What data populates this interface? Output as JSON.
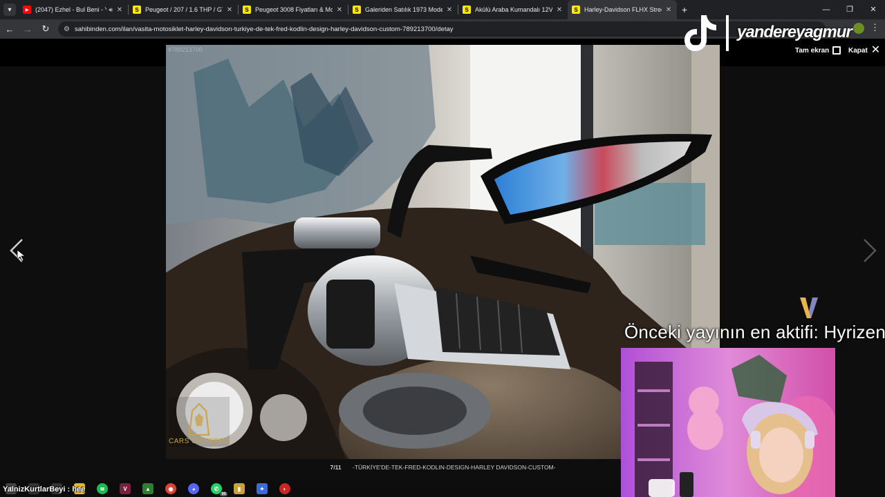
{
  "browser": {
    "tabs": [
      {
        "label": "(2047) Ezhel - Bul Beni - Yo",
        "favicon": "youtube-icon",
        "has_audio": true
      },
      {
        "label": "Peugeot / 207 / 1.6 THP / GT / ...",
        "favicon": "sahibinden-icon"
      },
      {
        "label": "Peugeot 3008 Fiyatları & Mode",
        "favicon": "sahibinden-icon"
      },
      {
        "label": "Galeriden Satılık 1973 Model K",
        "favicon": "sahibinden-icon"
      },
      {
        "label": "Akülü Araba Kumandalı 12V Ve",
        "favicon": "sahibinden-icon"
      },
      {
        "label": "Harley-Davidson FLHX Street G",
        "favicon": "sahibinden-icon",
        "active": true
      }
    ],
    "favicon_letter": "S",
    "new_tab_symbol": "+",
    "url": "sahibinden.com/ilan/vasita-motosiklet-harley-davidson-turkiye-de-tek-fred-kodlin-design-harley-davidson-custom-789213700/detay"
  },
  "viewer": {
    "photo_id": "#789213700",
    "watermark_brand": "CARS OF FERRO",
    "counter": "7/11",
    "caption": "-TÜRKİYE'DE-TEK-FRED-KODLIN-DESIGN-HARLEY DAVIDSON-CUSTOM-",
    "fullscreen_label": "Tam ekran",
    "close_label": "Kapat"
  },
  "stream": {
    "tiktok_username": "yandereyagmur",
    "previous_top_chatter": "Önceki yayının en aktifi: Hyrizen",
    "chat_message": "YalnizKurtlarBeyi : hee"
  },
  "taskbar": {
    "whatsapp_badge": "90"
  },
  "colors": {
    "chrome_dark": "#202124",
    "chrome_mid": "#35363a",
    "sahibinden_yellow": "#ffe800",
    "ferro_gold": "#c9a24a"
  }
}
